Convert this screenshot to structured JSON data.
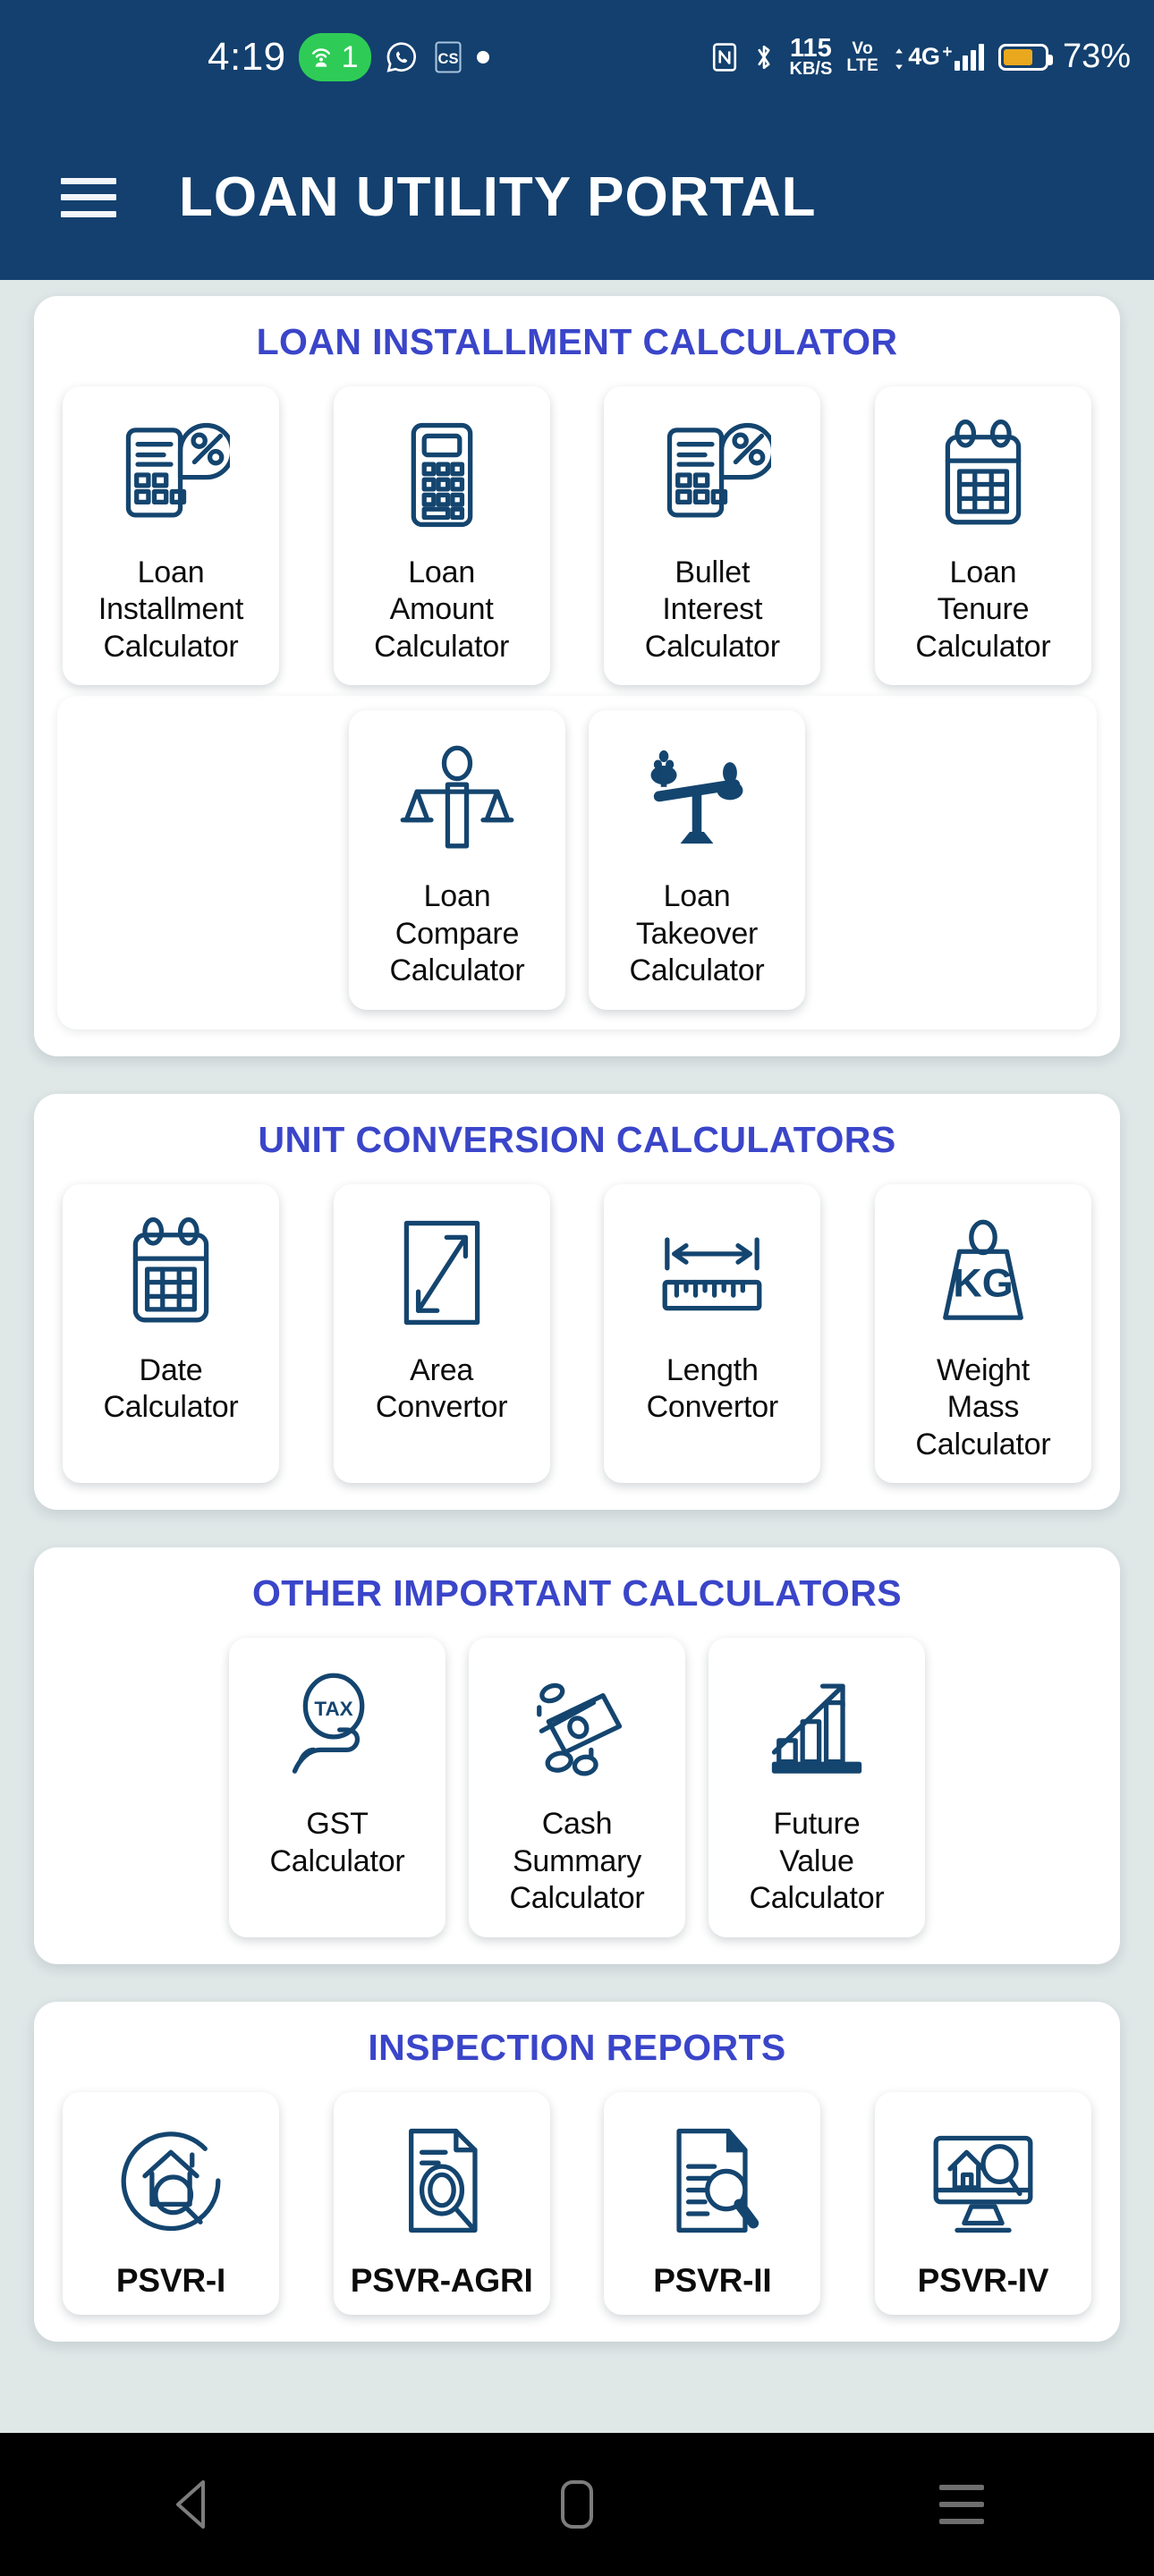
{
  "status_bar": {
    "time": "4:19",
    "hotspot_count": "1",
    "hotspot_icon": "hotspot-icon",
    "whatsapp_icon": "whatsapp-icon",
    "cs_icon": "cs-app-icon",
    "notification_dot": "notification-dot-icon",
    "nfc_icon": "nfc-icon",
    "bluetooth_icon": "bluetooth-icon",
    "net_speed_value": "115",
    "net_speed_unit": "KB/S",
    "volte_top": "Vo",
    "volte_bottom": "LTE",
    "network_type": "4G",
    "network_plus": "+",
    "signal_icon": "signal-bars-icon",
    "battery_icon": "battery-icon",
    "battery_percent": "73%"
  },
  "app_bar": {
    "menu_icon": "hamburger-menu-icon",
    "title": "LOAN UTILITY PORTAL"
  },
  "colors": {
    "header_navy": "#13406e",
    "page_background": "#dfe7e7",
    "section_title_blue": "#3a45c9",
    "icon_navy": "#14456f",
    "hotspot_green": "#2ecc56",
    "battery_amber": "#eaa81f"
  },
  "sections": [
    {
      "id": "loan-installment-calculator",
      "title": "LOAN INSTALLMENT CALCULATOR",
      "rows": [
        {
          "layout": "spread",
          "tiles": [
            {
              "icon": "calculator-pie-percent-icon",
              "label": "Loan\nInstallment\nCalculator"
            },
            {
              "icon": "calculator-icon",
              "label": "Loan\nAmount\nCalculator"
            },
            {
              "icon": "calculator-pie-percent-icon",
              "label": "Bullet\nInterest\nCalculator"
            },
            {
              "icon": "calendar-icon",
              "label": "Loan\nTenure\nCalculator"
            }
          ]
        },
        {
          "layout": "inner",
          "tiles": [
            {
              "icon": "balance-scale-person-icon",
              "label": "Loan\nCompare\nCalculator"
            },
            {
              "icon": "tilted-scale-icon",
              "label": "Loan\nTakeover\nCalculator"
            }
          ]
        }
      ]
    },
    {
      "id": "unit-conversion-calculators",
      "title": "UNIT CONVERSION CALCULATORS",
      "rows": [
        {
          "layout": "spread",
          "tiles": [
            {
              "icon": "calendar-icon",
              "label": "Date\nCalculator"
            },
            {
              "icon": "area-diagonal-arrow-icon",
              "label": "Area\nConvertor"
            },
            {
              "icon": "ruler-length-icon",
              "label": "Length\nConvertor"
            },
            {
              "icon": "kg-weight-icon",
              "label": "Weight\nMass\nCalculator"
            }
          ]
        }
      ]
    },
    {
      "id": "other-important-calculators",
      "title": "OTHER IMPORTANT CALCULATORS",
      "rows": [
        {
          "layout": "center",
          "tiles": [
            {
              "icon": "tax-hand-icon",
              "label": "GST\nCalculator"
            },
            {
              "icon": "cash-notes-coins-icon",
              "label": "Cash\nSummary\nCalculator"
            },
            {
              "icon": "growth-bar-chart-icon",
              "label": "Future\nValue\nCalculator"
            }
          ]
        }
      ]
    },
    {
      "id": "inspection-reports",
      "title": "INSPECTION REPORTS",
      "rows": [
        {
          "layout": "spread",
          "tiles": [
            {
              "icon": "house-magnifier-icon",
              "label": "PSVR-I",
              "emphasis": true
            },
            {
              "icon": "document-magnifier-icon",
              "label": "PSVR-AGRI",
              "emphasis": true
            },
            {
              "icon": "report-magnifier-icon",
              "label": "PSVR-II",
              "emphasis": true
            },
            {
              "icon": "monitor-house-magnifier-icon",
              "label": "PSVR-IV",
              "emphasis": true
            }
          ]
        }
      ]
    }
  ],
  "nav_bar": {
    "back_icon": "back-triangle-icon",
    "home_icon": "home-pill-icon",
    "recents_icon": "recents-lines-icon"
  }
}
